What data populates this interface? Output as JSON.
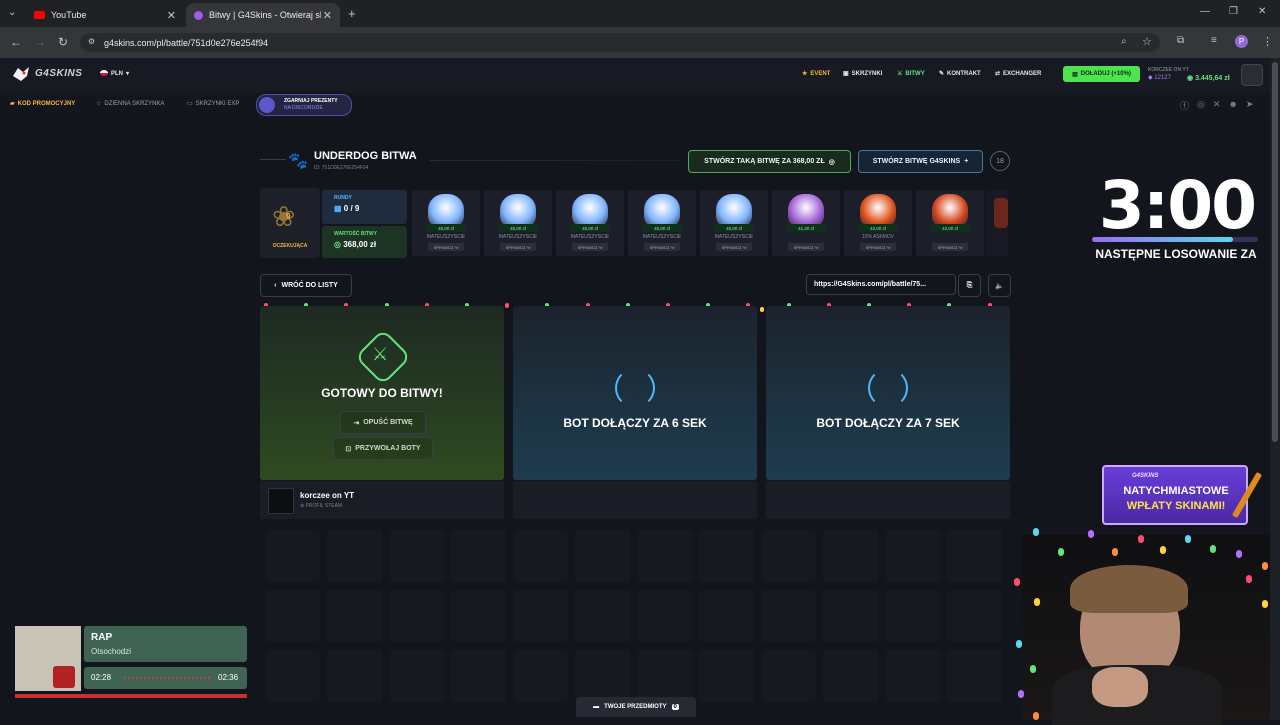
{
  "browser": {
    "tabs": [
      {
        "title": "YouTube",
        "active": false
      },
      {
        "title": "Bitwy | G4Skins - Otwieraj skrzy",
        "active": true
      }
    ],
    "url": "g4skins.com/pl/battle/751d0e276e254f94",
    "profile_letter": "P"
  },
  "header": {
    "logo": "G4SKINS",
    "currency": "PLN",
    "nav": [
      "EVENT",
      "SKRZYNKI",
      "BITWY",
      "KONTRAKT",
      "EXCHANGER"
    ],
    "deposit_label": "DOŁADUJ (+10%)",
    "user": {
      "name": "KORCZEE ON YT",
      "points": "12127",
      "balance": "3.445,64 zł"
    }
  },
  "subheader": {
    "promo": "KOD PROMOCYJNY",
    "daily": "DZIENNA SKRZYNKA",
    "exp": "SKRZYNKI EXP",
    "discord_title": "ZGARNIAJ PREZENTY",
    "discord_sub": "NA DISCORDZIE"
  },
  "battle": {
    "title": "UNDERDOG BITWA",
    "id": "ID: 751D0E276E254F94",
    "create_same": "STWÓRZ TAKĄ BITWĘ ZA 368,00 ZŁ",
    "create_g4": "STWÓRZ BITWĘ G4SKINS",
    "age_badge": "18",
    "status_count": "9",
    "status_label": "OCZEKUJĄCA",
    "rounds_label": "RUNDY",
    "rounds_value": "0 / 9",
    "value_label": "WARTOŚĆ BITWY",
    "value": "368,00 zł",
    "cases": [
      {
        "price": "40,00 zł",
        "name": "MATEUSZYSCIE",
        "check": "SPRAWDŹ %",
        "color": "#7fb3ff"
      },
      {
        "price": "40,00 zł",
        "name": "MATEUSZYSCIE",
        "check": "SPRAWDŹ %",
        "color": "#7fb3ff"
      },
      {
        "price": "40,00 zł",
        "name": "MATEUSZYSCIE",
        "check": "SPRAWDŹ %",
        "color": "#7fb3ff"
      },
      {
        "price": "40,00 zł",
        "name": "MATEUSZYSCIE",
        "check": "SPRAWDŹ %",
        "color": "#7fb3ff"
      },
      {
        "price": "40,00 zł",
        "name": "MATEUSZYSCIE",
        "check": "SPRAWDŹ %",
        "color": "#7fb3ff"
      },
      {
        "price": "41,20 zł",
        "name": "",
        "check": "SPRAWDŹ %",
        "color": "#a565d9"
      },
      {
        "price": "42,00 zł",
        "name": "10% ASIIMOV",
        "check": "SPRAWDŹ %",
        "color": "#e0531e"
      },
      {
        "price": "42,00 zł",
        "name": "",
        "check": "SPRAWDŹ %",
        "color": "#d4471f"
      }
    ],
    "back_label": "WRÓĆ DO LISTY",
    "share_url": "https://G4Skins.com/pl/battle/75...",
    "ready_label": "GOTOWY DO BITWY!",
    "leave_label": "OPUŚĆ BITWĘ",
    "call_bots_label": "PRZYWOŁAJ BOTY",
    "bot1_label": "BOT DOŁĄCZY ZA 6 SEK",
    "bot2_label": "BOT DOŁĄCZY ZA 7 SEK",
    "player_name": "korczee on YT",
    "player_profile": "PROFIL STEAM"
  },
  "overlay": {
    "timer": "3:00",
    "timer_caption": "NASTĘPNE LOSOWANIE ZA",
    "timer_progress": 0.85,
    "promo_brand": "G4SKINS",
    "promo_line1": "NATYCHMIASTOWE",
    "promo_line2": "WPŁATY SKINAMI!"
  },
  "music": {
    "title": "RAP",
    "artist": "Otsochodzi",
    "elapsed": "02:28",
    "total": "02:36"
  },
  "footer": {
    "items_label": "TWOJE PRZEDMIOTY",
    "items_count": "0"
  }
}
